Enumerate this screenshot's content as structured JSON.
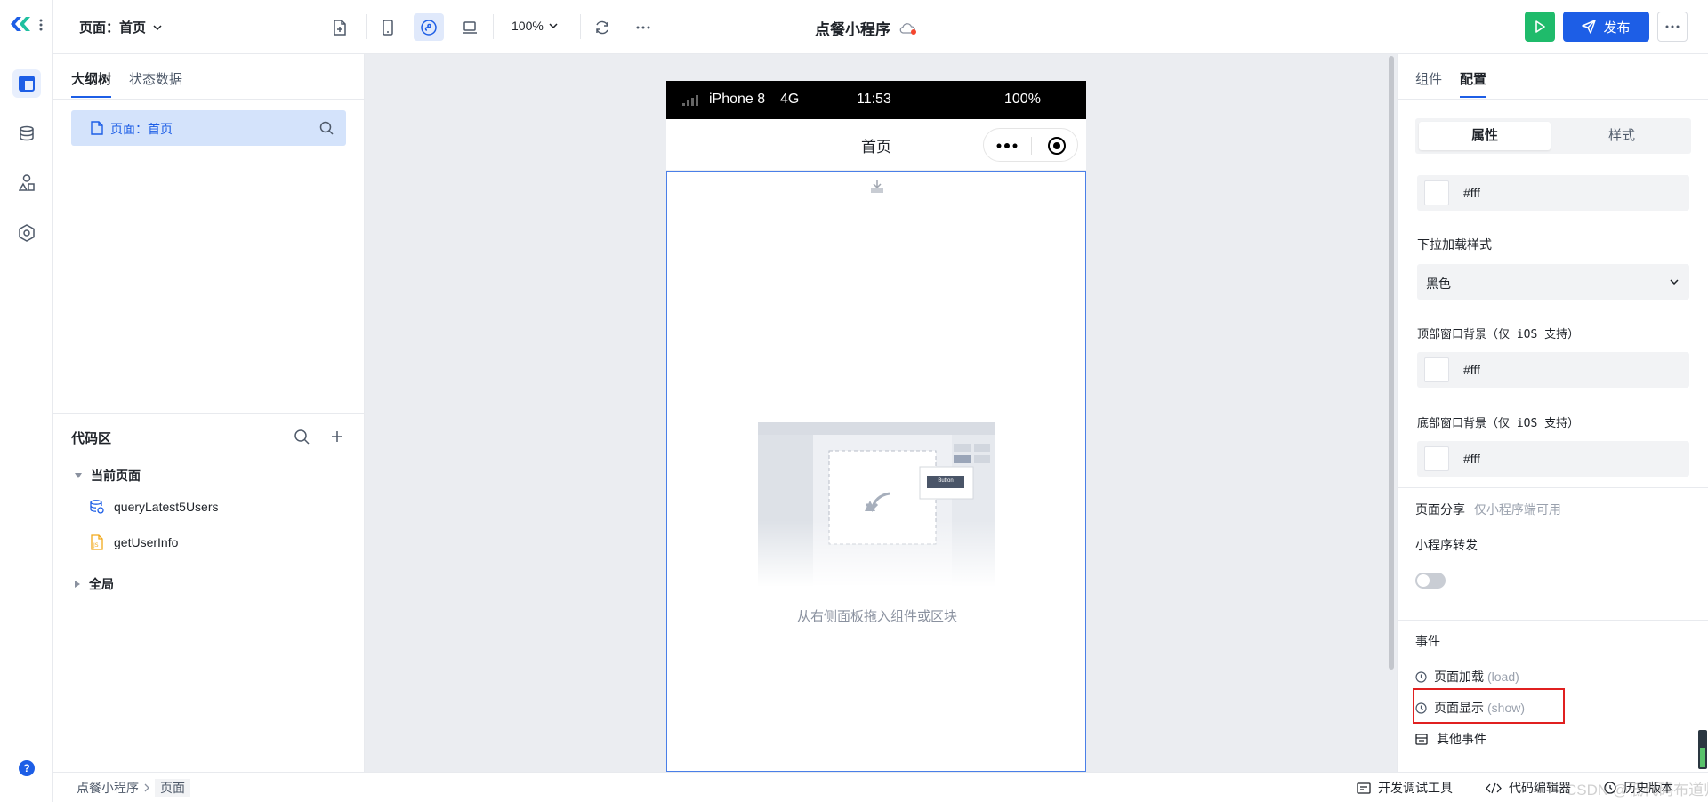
{
  "app": {
    "page_selector": "页面：首页",
    "zoom": "100%",
    "title": "点餐小程序",
    "publish_label": "发布"
  },
  "left_panel": {
    "tabs": [
      "大纲树",
      "状态数据"
    ],
    "outline_item": "页面：首页",
    "code_section": {
      "title": "代码区",
      "current_page_label": "当前页面",
      "items": [
        "queryLatest5Users",
        "getUserInfo"
      ],
      "global_label": "全局"
    }
  },
  "phone": {
    "carrier": "iPhone 8",
    "network": "4G",
    "time": "11:53",
    "battery": "100%",
    "nav_title": "首页",
    "empty_hint": "从右侧面板拖入组件或区块",
    "illustration_button": "Button"
  },
  "right_panel": {
    "tabs": [
      "组件",
      "配置"
    ],
    "segment": [
      "属性",
      "样式"
    ],
    "top_color_value": "#fff",
    "pull_style_label": "下拉加载样式",
    "pull_style_value": "黑色",
    "top_window_bg_label": "顶部窗口背景（仅 iOS 支持）",
    "top_window_bg_value": "#fff",
    "bottom_window_bg_label": "底部窗口背景（仅 iOS 支持）",
    "bottom_window_bg_value": "#fff",
    "share_label": "页面分享",
    "share_note": "仅小程序端可用",
    "forward_label": "小程序转发",
    "forward_enabled": false,
    "events_title": "事件",
    "events": [
      {
        "name": "页面加载",
        "code": "(load)"
      },
      {
        "name": "页面显示",
        "code": "(show)"
      }
    ],
    "other_events": "其他事件"
  },
  "status_bar": {
    "breadcrumb": [
      "点餐小程序",
      "页面"
    ],
    "dev_tools": "开发调试工具",
    "code_editor": "代码编辑器",
    "history": "历史版本",
    "watermark": "CSDN @低代码布道师"
  },
  "colors": {
    "accent": "#1d5ee6",
    "run_green": "#1fbb6b",
    "highlight_box": "#e02020"
  }
}
